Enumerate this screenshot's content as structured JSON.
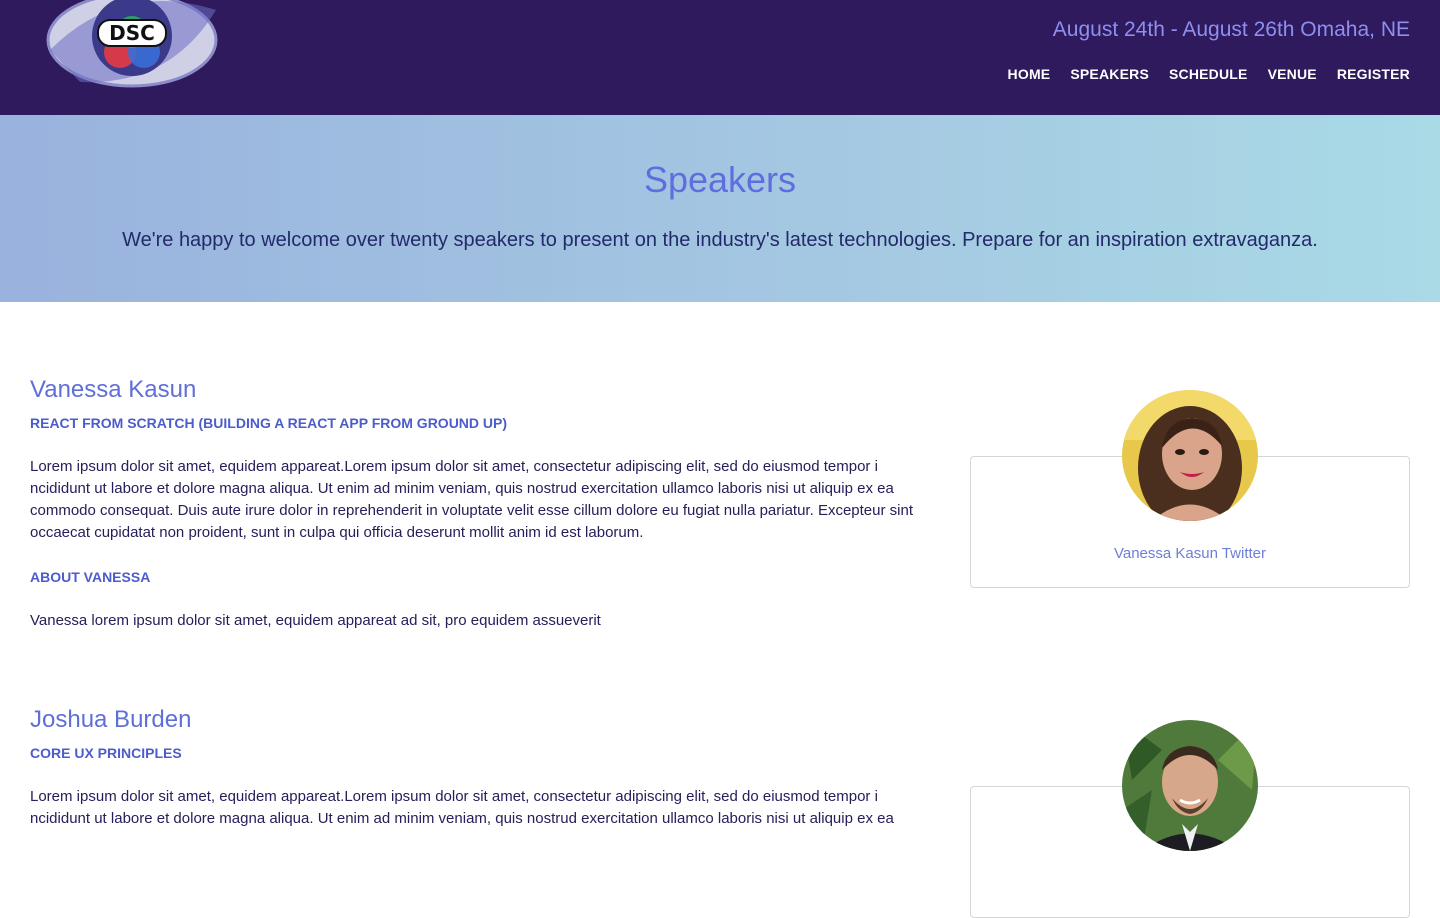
{
  "header": {
    "logo_text": "DSC",
    "dates": "August 24th - August 26th Omaha, NE",
    "nav": [
      {
        "label": "HOME"
      },
      {
        "label": "SPEAKERS"
      },
      {
        "label": "SCHEDULE"
      },
      {
        "label": "VENUE"
      },
      {
        "label": "REGISTER"
      }
    ]
  },
  "hero": {
    "title": "Speakers",
    "subtitle": "We're happy to welcome over twenty speakers to present on the industry's latest technologies. Prepare for an inspiration extravaganza."
  },
  "speakers": [
    {
      "name": "Vanessa Kasun",
      "talk": "REACT FROM SCRATCH (BUILDING A REACT APP FROM GROUND UP)",
      "description": "Lorem ipsum dolor sit amet, equidem appareat.Lorem ipsum dolor sit amet, consectetur adipiscing elit, sed do eiusmod tempor i ncididunt ut labore et dolore magna aliqua. Ut enim ad minim veniam, quis nostrud exercitation ullamco laboris nisi ut aliquip ex ea commodo consequat. Duis aute irure dolor in reprehenderit in voluptate velit esse cillum dolore eu fugiat nulla pariatur. Excepteur sint occaecat cupidatat non proident, sunt in culpa qui officia deserunt mollit anim id est laborum.",
      "about_heading": "ABOUT VANESSA",
      "about": "Vanessa lorem ipsum dolor sit amet, equidem appareat ad sit, pro equidem assueverit",
      "twitter_label": "Vanessa Kasun Twitter"
    },
    {
      "name": "Joshua Burden",
      "talk": "CORE UX PRINCIPLES",
      "description": "Lorem ipsum dolor sit amet, equidem appareat.Lorem ipsum dolor sit amet, consectetur adipiscing elit, sed do eiusmod tempor i ncididunt ut labore et dolore magna aliqua. Ut enim ad minim veniam, quis nostrud exercitation ullamco laboris nisi ut aliquip ex ea"
    }
  ],
  "colors": {
    "header_bg": "#2e1a5c",
    "accent": "#5f6fd8",
    "hero_gradient_start": "#99b2de",
    "hero_gradient_end": "#a9dae6"
  }
}
